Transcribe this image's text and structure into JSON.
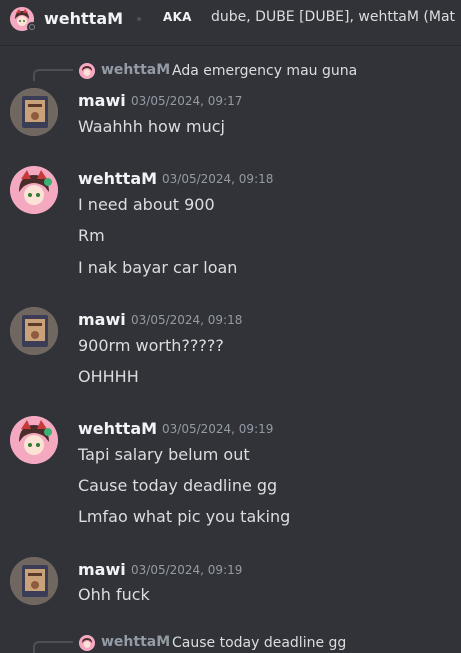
{
  "header": {
    "name": "wehttaM",
    "aka": "AKA",
    "aliases": "dube, DUBE [DUBE], wehttaM (Mat"
  },
  "messages": [
    {
      "reply": {
        "author": "wehttaM",
        "text": "Ada emergency mau guna"
      },
      "author": "mawi",
      "timestamp": "03/05/2024, 09:17",
      "lines": [
        "Waahhh how mucj"
      ]
    },
    {
      "author": "wehttaM",
      "timestamp": "03/05/2024, 09:18",
      "lines": [
        "I need about 900",
        "Rm",
        "I nak bayar car loan"
      ]
    },
    {
      "author": "mawi",
      "timestamp": "03/05/2024, 09:18",
      "lines": [
        "900rm worth?????",
        "OHHHH"
      ]
    },
    {
      "author": "wehttaM",
      "timestamp": "03/05/2024, 09:19",
      "lines": [
        "Tapi salary belum out",
        "Cause today deadline gg",
        "Lmfao what pic you taking"
      ]
    },
    {
      "author": "mawi",
      "timestamp": "03/05/2024, 09:19",
      "lines": [
        "Ohh fuck"
      ]
    },
    {
      "reply": {
        "author": "wehttaM",
        "text": "Cause today deadline gg"
      }
    }
  ]
}
